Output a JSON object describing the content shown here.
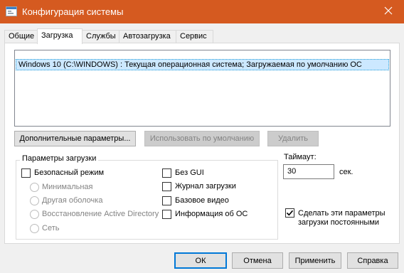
{
  "window": {
    "title": "Конфигурация системы",
    "icon": "msconfig-icon",
    "close_icon": "close-icon"
  },
  "tabs": [
    {
      "label": "Общие",
      "active": false
    },
    {
      "label": "Загрузка",
      "active": true
    },
    {
      "label": "Службы",
      "active": false
    },
    {
      "label": "Автозагрузка",
      "active": false
    },
    {
      "label": "Сервис",
      "active": false
    }
  ],
  "os_list": [
    {
      "label": "Windows 10 (C:\\WINDOWS) : Текущая операционная система; Загружаемая по умолчанию ОС",
      "selected": true
    }
  ],
  "buttons": {
    "advanced": "Дополнительные параметры...",
    "set_default": "Использовать по умолчанию",
    "delete": "Удалить"
  },
  "boot_options": {
    "label": "Параметры загрузки",
    "safe_boot": {
      "label": "Безопасный режим",
      "checked": false
    },
    "safe_modes": [
      {
        "label": "Минимальная",
        "selected": false
      },
      {
        "label": "Другая оболочка",
        "selected": false
      },
      {
        "label": "Восстановление Active Directory",
        "selected": false
      },
      {
        "label": "Сеть",
        "selected": false
      }
    ],
    "right_options": [
      {
        "label": "Без GUI",
        "checked": false
      },
      {
        "label": "Журнал загрузки",
        "checked": false
      },
      {
        "label": "Базовое видео",
        "checked": false
      },
      {
        "label": "Информация  об ОС",
        "checked": false
      }
    ]
  },
  "timeout": {
    "label": "Таймаут:",
    "value": "30",
    "unit": "сек."
  },
  "persistent": {
    "label_line1": "Сделать эти параметры",
    "label_line2": "загрузки постоянными",
    "checked": true
  },
  "footer": {
    "ok": "ОК",
    "cancel": "Отмена",
    "apply": "Применить",
    "help": "Справка"
  },
  "colors": {
    "titlebar": "#d55a20",
    "selection": "#cce8ff",
    "default_button_border": "#0078d7"
  }
}
